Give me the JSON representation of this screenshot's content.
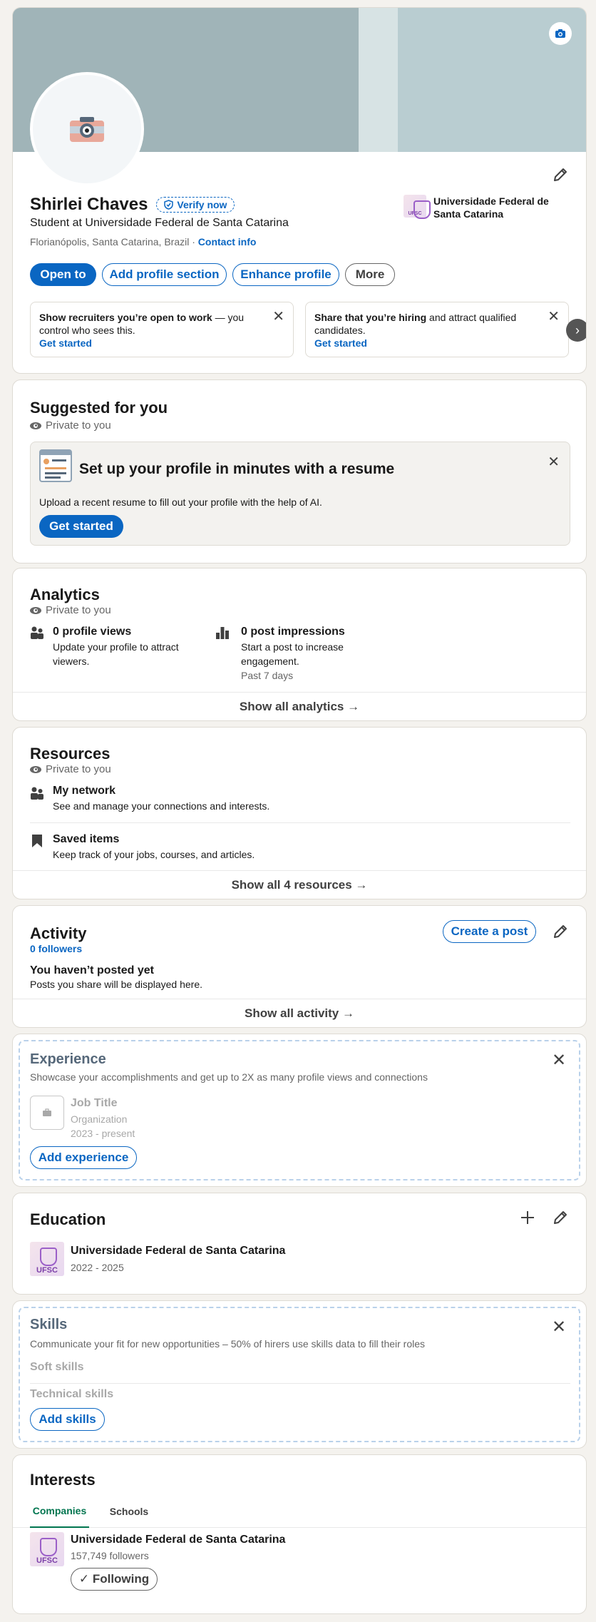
{
  "profile": {
    "name": "Shirlei Chaves",
    "verify_label": "Verify now",
    "headline": "Student at Universidade Federal de Santa Catarina",
    "location": "Florianópolis, Santa Catarina, Brazil",
    "separator": "·",
    "contact_info": "Contact info",
    "school_name": "Universidade Federal de Santa Catarina",
    "school_logo_text": "UFSC",
    "buttons": {
      "open_to": "Open to",
      "add_section": "Add profile section",
      "enhance": "Enhance profile",
      "more": "More"
    },
    "promo_cards": [
      {
        "bold": "Show recruiters you’re open to work",
        "text": " — you control who sees this.",
        "link": "Get started"
      },
      {
        "bold": "Share that you’re hiring",
        "text": " and attract qualified candidates.",
        "link": "Get started"
      }
    ]
  },
  "suggested": {
    "title": "Suggested for you",
    "private": "Private to you",
    "resume_title": "Set up your profile in minutes with a resume",
    "resume_desc": "Upload a recent resume to fill out your profile with the help of AI.",
    "get_started": "Get started"
  },
  "analytics": {
    "title": "Analytics",
    "private": "Private to you",
    "views_title": "0 profile views",
    "views_desc": "Update your profile to attract viewers.",
    "impressions_title": "0 post impressions",
    "impressions_desc": "Start a post to increase engagement.",
    "impressions_period": "Past 7 days",
    "show_all": "Show all analytics →"
  },
  "resources": {
    "title": "Resources",
    "private": "Private to you",
    "network_title": "My network",
    "network_desc": "See and manage your connections and interests.",
    "saved_title": "Saved items",
    "saved_desc": "Keep track of your jobs, courses, and articles.",
    "show_all": "Show all 4 resources →"
  },
  "activity": {
    "title": "Activity",
    "followers": "0 followers",
    "create_post": "Create a post",
    "empty_title": "You haven’t posted yet",
    "empty_desc": "Posts you share will be displayed here.",
    "show_all": "Show all activity →"
  },
  "experience": {
    "title": "Experience",
    "desc": "Showcase your accomplishments and get up to 2X as many profile views and connections",
    "job_title": "Job Title",
    "organization": "Organization",
    "dates": "2023 - present",
    "add": "Add experience"
  },
  "education": {
    "title": "Education",
    "school": "Universidade Federal de Santa Catarina",
    "years": "2022 - 2025",
    "logo_text": "UFSC"
  },
  "skills": {
    "title": "Skills",
    "desc": "Communicate your fit for new opportunities – 50% of hirers use skills data to fill their roles",
    "soft": "Soft skills",
    "technical": "Technical skills",
    "add": "Add skills"
  },
  "interests": {
    "title": "Interests",
    "tabs": [
      "Companies",
      "Schools"
    ],
    "company": "Universidade Federal de Santa Catarina",
    "followers": "157,749 followers",
    "following": "✓ Following",
    "logo_text": "UFSC"
  },
  "colors": {
    "accent": "#0a66c2",
    "banner": "#a0b4b8",
    "banner_light": "#b9cdd1",
    "tab_active": "#01754f"
  }
}
